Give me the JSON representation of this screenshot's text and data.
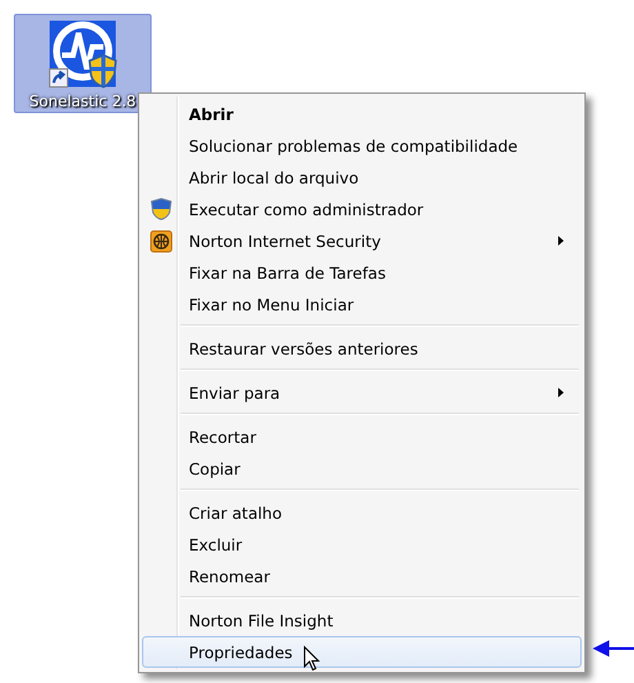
{
  "desktop_icon": {
    "label": "Sonelastic 2.8",
    "selected": true
  },
  "context_menu": {
    "groups": [
      {
        "items": [
          {
            "label": "Abrir",
            "default": true,
            "selected": false
          },
          {
            "label": "Solucionar problemas de compatibilidade",
            "selected": false
          },
          {
            "label": "Abrir local do arquivo",
            "selected": false
          },
          {
            "label": "Executar como administrador",
            "kind": "shield",
            "selected": false
          },
          {
            "label": "Norton Internet Security",
            "kind": "globe",
            "submenu": true,
            "selected": false
          },
          {
            "label": "Fixar na Barra de Tarefas",
            "selected": false
          },
          {
            "label": "Fixar no Menu Iniciar",
            "selected": false
          }
        ]
      },
      {
        "items": [
          {
            "label": "Restaurar versões anteriores",
            "selected": false
          }
        ]
      },
      {
        "items": [
          {
            "label": "Enviar para",
            "submenu": true,
            "selected": false
          }
        ]
      },
      {
        "items": [
          {
            "label": "Recortar",
            "selected": false
          },
          {
            "label": "Copiar",
            "selected": false
          }
        ]
      },
      {
        "items": [
          {
            "label": "Criar atalho",
            "selected": false
          },
          {
            "label": "Excluir",
            "selected": false
          },
          {
            "label": "Renomear",
            "selected": false
          }
        ]
      },
      {
        "items": [
          {
            "label": "Norton File Insight",
            "selected": false
          },
          {
            "label": "Propriedades",
            "selected": true
          }
        ]
      }
    ]
  }
}
